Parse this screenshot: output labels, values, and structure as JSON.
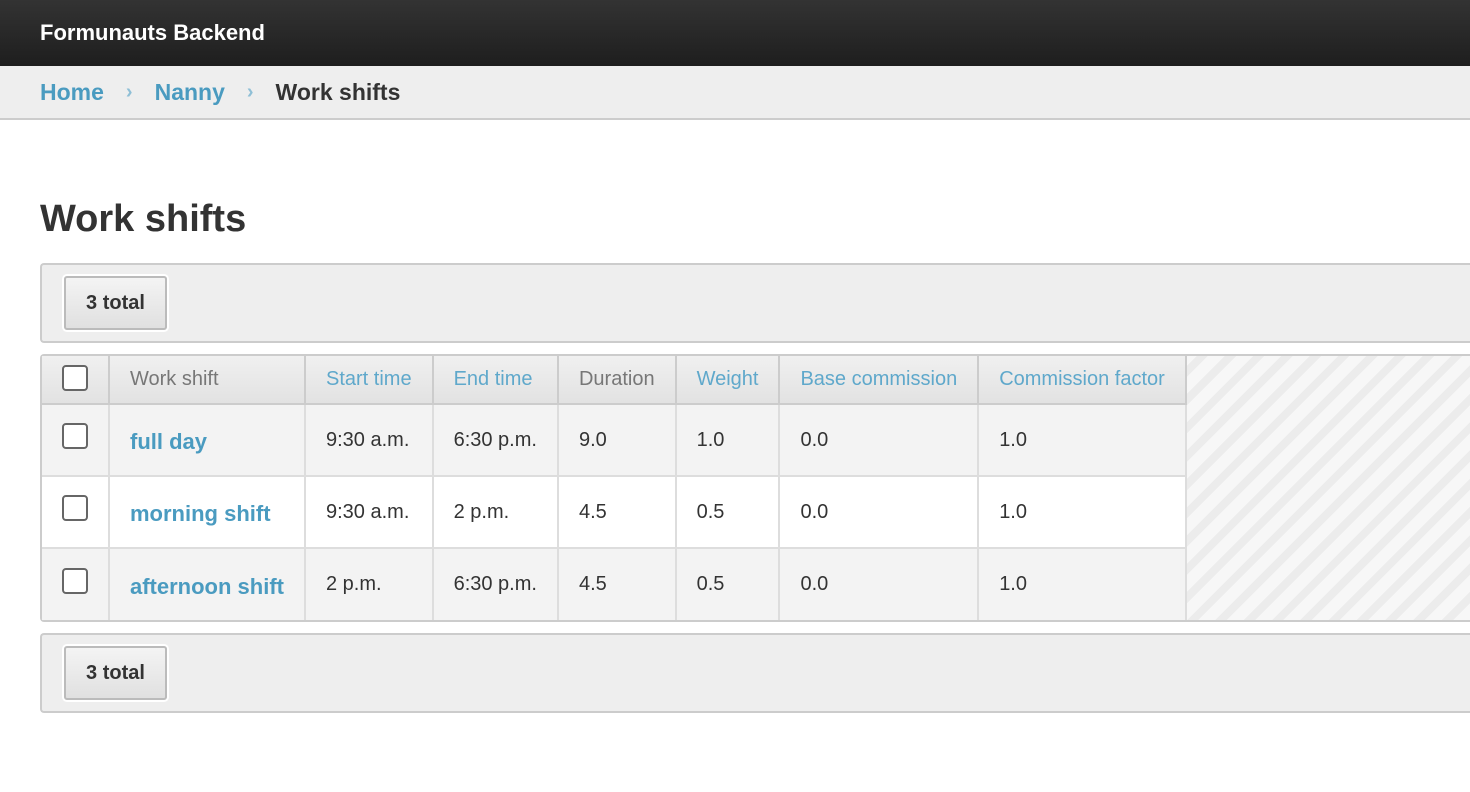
{
  "header": {
    "title": "Formunauts Backend"
  },
  "breadcrumbs": {
    "items": [
      {
        "label": "Home"
      },
      {
        "label": "Nanny"
      }
    ],
    "separator": "›",
    "current": "Work shifts"
  },
  "page": {
    "title": "Work shifts"
  },
  "paginator": {
    "top_label": "3 total",
    "bottom_label": "3 total"
  },
  "table": {
    "columns": [
      {
        "label": "Work shift",
        "sortable": false
      },
      {
        "label": "Start time",
        "sortable": true
      },
      {
        "label": "End time",
        "sortable": true
      },
      {
        "label": "Duration",
        "sortable": false
      },
      {
        "label": "Weight",
        "sortable": true
      },
      {
        "label": "Base commission",
        "sortable": true
      },
      {
        "label": "Commission factor",
        "sortable": true
      }
    ],
    "rows": [
      {
        "name": "full day",
        "start": "9:30 a.m.",
        "end": "6:30 p.m.",
        "duration": "9.0",
        "weight": "1.0",
        "base_commission": "0.0",
        "commission_factor": "1.0"
      },
      {
        "name": "morning shift",
        "start": "9:30 a.m.",
        "end": "2 p.m.",
        "duration": "4.5",
        "weight": "0.5",
        "base_commission": "0.0",
        "commission_factor": "1.0"
      },
      {
        "name": "afternoon shift",
        "start": "2 p.m.",
        "end": "6:30 p.m.",
        "duration": "4.5",
        "weight": "0.5",
        "base_commission": "0.0",
        "commission_factor": "1.0"
      }
    ]
  },
  "colors": {
    "link": "#4a9bc0",
    "header_bg": "#1e1e1e",
    "sortable_header": "#5fa8cb"
  }
}
